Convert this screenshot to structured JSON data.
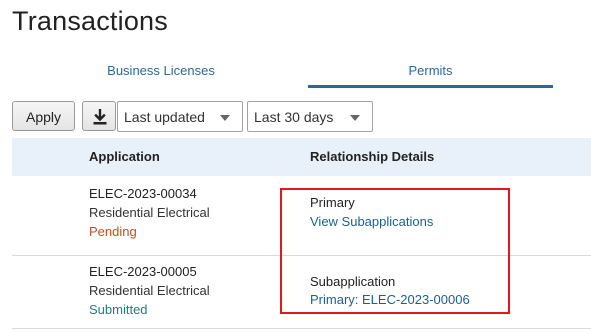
{
  "page": {
    "title": "Transactions"
  },
  "tabs": [
    {
      "label": "Business Licenses",
      "active": false
    },
    {
      "label": "Permits",
      "active": true
    }
  ],
  "toolbar": {
    "apply_label": "Apply",
    "download_icon": "download-icon",
    "sort_select": {
      "value": "Last updated"
    },
    "range_select": {
      "value": "Last 30 days"
    }
  },
  "table": {
    "columns": [
      "Application",
      "Relationship Details"
    ],
    "rows": [
      {
        "id": "ELEC-2023-00034",
        "type": "Residential Electrical",
        "status": "Pending",
        "relationship": "Primary",
        "link": "View Subapplications"
      },
      {
        "id": "ELEC-2023-00005",
        "type": "Residential Electrical",
        "status": "Submitted",
        "relationship": "Subapplication",
        "link": "Primary: ELEC-2023-00006"
      }
    ]
  },
  "colors": {
    "accent": "#2b6a96",
    "pending": "#c0501b",
    "submitted": "#247e80",
    "highlight": "#e0191d",
    "header_bg": "#e8f1f9"
  }
}
